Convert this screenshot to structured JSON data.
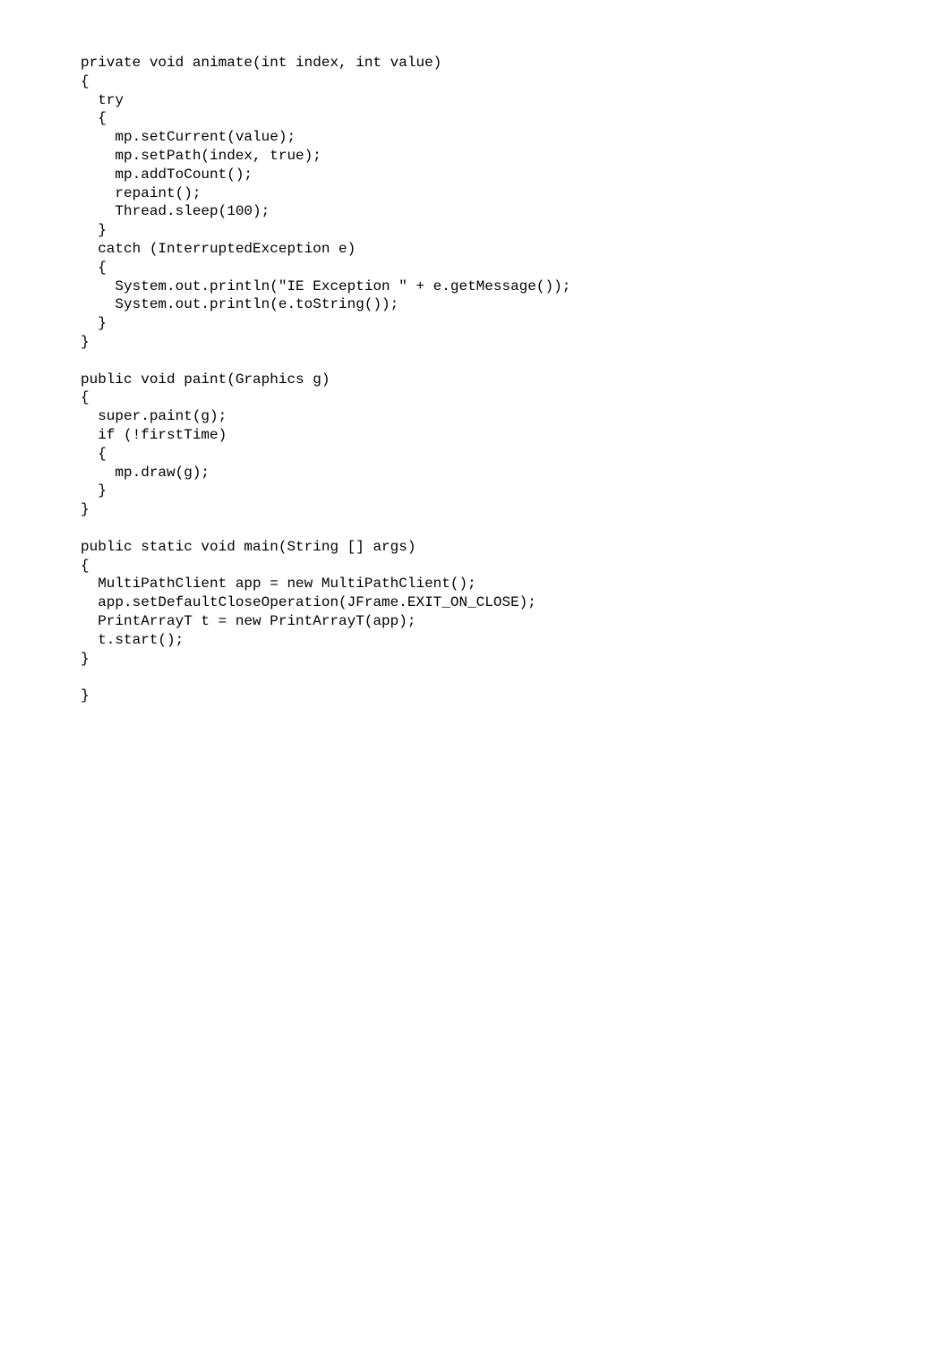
{
  "code": {
    "lines": [
      "private void animate(int index, int value)",
      "{",
      "  try",
      "  {",
      "    mp.setCurrent(value);",
      "    mp.setPath(index, true);",
      "    mp.addToCount();",
      "    repaint();",
      "    Thread.sleep(100);",
      "  }",
      "  catch (InterruptedException e)",
      "  {",
      "    System.out.println(\"IE Exception \" + e.getMessage());",
      "    System.out.println(e.toString());",
      "  }",
      "}",
      "",
      "public void paint(Graphics g)",
      "{",
      "  super.paint(g);",
      "  if (!firstTime)",
      "  {",
      "    mp.draw(g);",
      "  }",
      "}",
      "",
      "public static void main(String [] args)",
      "{",
      "  MultiPathClient app = new MultiPathClient();",
      "  app.setDefaultCloseOperation(JFrame.EXIT_ON_CLOSE);",
      "  PrintArrayT t = new PrintArrayT(app);",
      "  t.start();",
      "}",
      "",
      "}"
    ]
  }
}
